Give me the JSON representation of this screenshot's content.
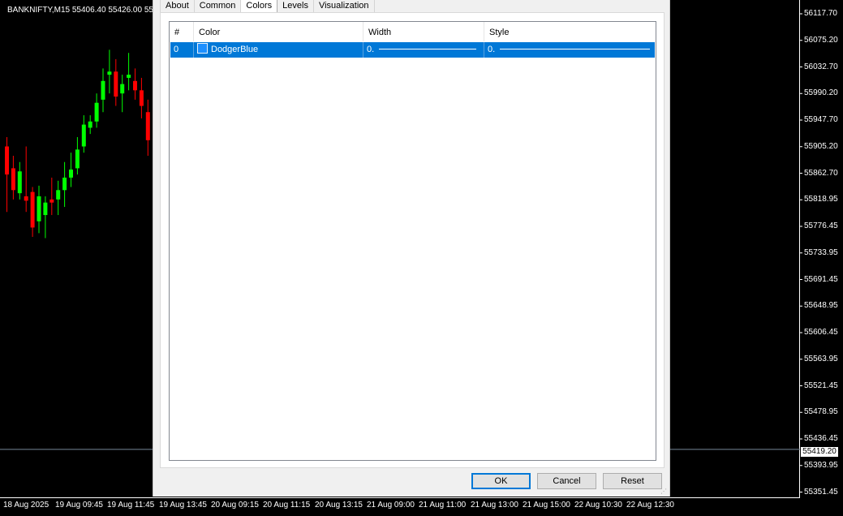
{
  "chart": {
    "title": "BANKNIFTY,M15  55406.40 55426.00 55",
    "price_labels": [
      "56117.70",
      "56075.20",
      "56032.70",
      "55990.20",
      "55947.70",
      "55905.20",
      "55862.70",
      "55818.95",
      "55776.45",
      "55733.95",
      "55691.45",
      "55648.95",
      "55606.45",
      "55563.95",
      "55521.45",
      "55478.95",
      "55436.45",
      "55393.95",
      "55351.45"
    ],
    "current_price": "55419.20",
    "time_labels": [
      "18 Aug 2025",
      "19 Aug 09:45",
      "19 Aug 11:45",
      "19 Aug 13:45",
      "20 Aug 09:15",
      "20 Aug 11:15",
      "20 Aug 13:15",
      "21 Aug 09:00",
      "21 Aug 11:00",
      "21 Aug 13:00",
      "21 Aug 15:00",
      "22 Aug 10:30",
      "22 Aug 12:30"
    ],
    "colors": {
      "bull": "#00ff00",
      "bear": "#ff0000",
      "background": "#000000",
      "grid_line": "#778899"
    },
    "candles": [
      {
        "o": 55905,
        "h": 55920,
        "l": 55800,
        "c": 55860
      },
      {
        "o": 55870,
        "h": 55890,
        "l": 55820,
        "c": 55835
      },
      {
        "o": 55830,
        "h": 55880,
        "l": 55820,
        "c": 55865
      },
      {
        "o": 55825,
        "h": 55905,
        "l": 55800,
        "c": 55818
      },
      {
        "o": 55832,
        "h": 55840,
        "l": 55760,
        "c": 55775
      },
      {
        "o": 55785,
        "h": 55842,
        "l": 55766,
        "c": 55825
      },
      {
        "o": 55795,
        "h": 55825,
        "l": 55758,
        "c": 55815
      },
      {
        "o": 55820,
        "h": 55855,
        "l": 55795,
        "c": 55815
      },
      {
        "o": 55820,
        "h": 55850,
        "l": 55795,
        "c": 55835
      },
      {
        "o": 55835,
        "h": 55880,
        "l": 55808,
        "c": 55855
      },
      {
        "o": 55855,
        "h": 55895,
        "l": 55840,
        "c": 55868
      },
      {
        "o": 55870,
        "h": 55920,
        "l": 55860,
        "c": 55900
      },
      {
        "o": 55905,
        "h": 55955,
        "l": 55895,
        "c": 55940
      },
      {
        "o": 55935,
        "h": 55955,
        "l": 55925,
        "c": 55945
      },
      {
        "o": 55945,
        "h": 55990,
        "l": 55935,
        "c": 55975
      },
      {
        "o": 55980,
        "h": 56030,
        "l": 55960,
        "c": 56010
      },
      {
        "o": 56020,
        "h": 56060,
        "l": 55990,
        "c": 56025
      },
      {
        "o": 56025,
        "h": 56045,
        "l": 55970,
        "c": 55985
      },
      {
        "o": 55990,
        "h": 56020,
        "l": 55960,
        "c": 56005
      },
      {
        "o": 56015,
        "h": 56055,
        "l": 55995,
        "c": 56020
      },
      {
        "o": 56010,
        "h": 56030,
        "l": 55980,
        "c": 55995
      },
      {
        "o": 55995,
        "h": 56015,
        "l": 55950,
        "c": 55970
      },
      {
        "o": 55960,
        "h": 55980,
        "l": 55890,
        "c": 55915
      }
    ]
  },
  "dialog": {
    "tabs": [
      "About",
      "Common",
      "Colors",
      "Levels",
      "Visualization"
    ],
    "active_tab": "Colors",
    "columns": [
      "#",
      "Color",
      "Width",
      "Style"
    ],
    "rows": [
      {
        "index": "0",
        "color_name": "DodgerBlue",
        "color_hex": "#1e90ff",
        "width": "0.",
        "style": "0."
      }
    ],
    "buttons": {
      "ok": "OK",
      "cancel": "Cancel",
      "reset": "Reset"
    }
  }
}
